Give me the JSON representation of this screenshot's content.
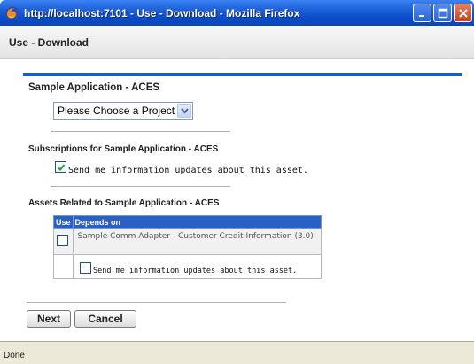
{
  "window": {
    "title": "http://localhost:7101 - Use - Download - Mozilla Firefox",
    "icon": "firefox-icon",
    "controls": [
      "minimize-icon",
      "maximize-icon",
      "close-icon"
    ]
  },
  "header": {
    "title": "Use - Download"
  },
  "application": {
    "title": "Sample Application - ACES",
    "project_select": {
      "selected": "Please Choose a Project"
    }
  },
  "subscriptions": {
    "title": "Subscriptions for Sample Application - ACES",
    "checkbox_label": "Send me information updates about this asset.",
    "checked": true
  },
  "related": {
    "title": "Assets Related to Sample Application - ACES",
    "columns": [
      "Use",
      "Depends on"
    ],
    "rows": [
      {
        "asset": "Sample Comm Adapter - Customer Credit Information (3.0)",
        "use_checked": false,
        "subscribe_label": "Send me information updates about this asset.",
        "subscribe_checked": false
      }
    ]
  },
  "buttons": {
    "next": "Next",
    "cancel": "Cancel"
  },
  "status": {
    "text": "Done"
  },
  "colors": {
    "titlebar": "#0a4bc9",
    "accent_rule": "#1a5fcf",
    "table_header": "#2960c8"
  }
}
